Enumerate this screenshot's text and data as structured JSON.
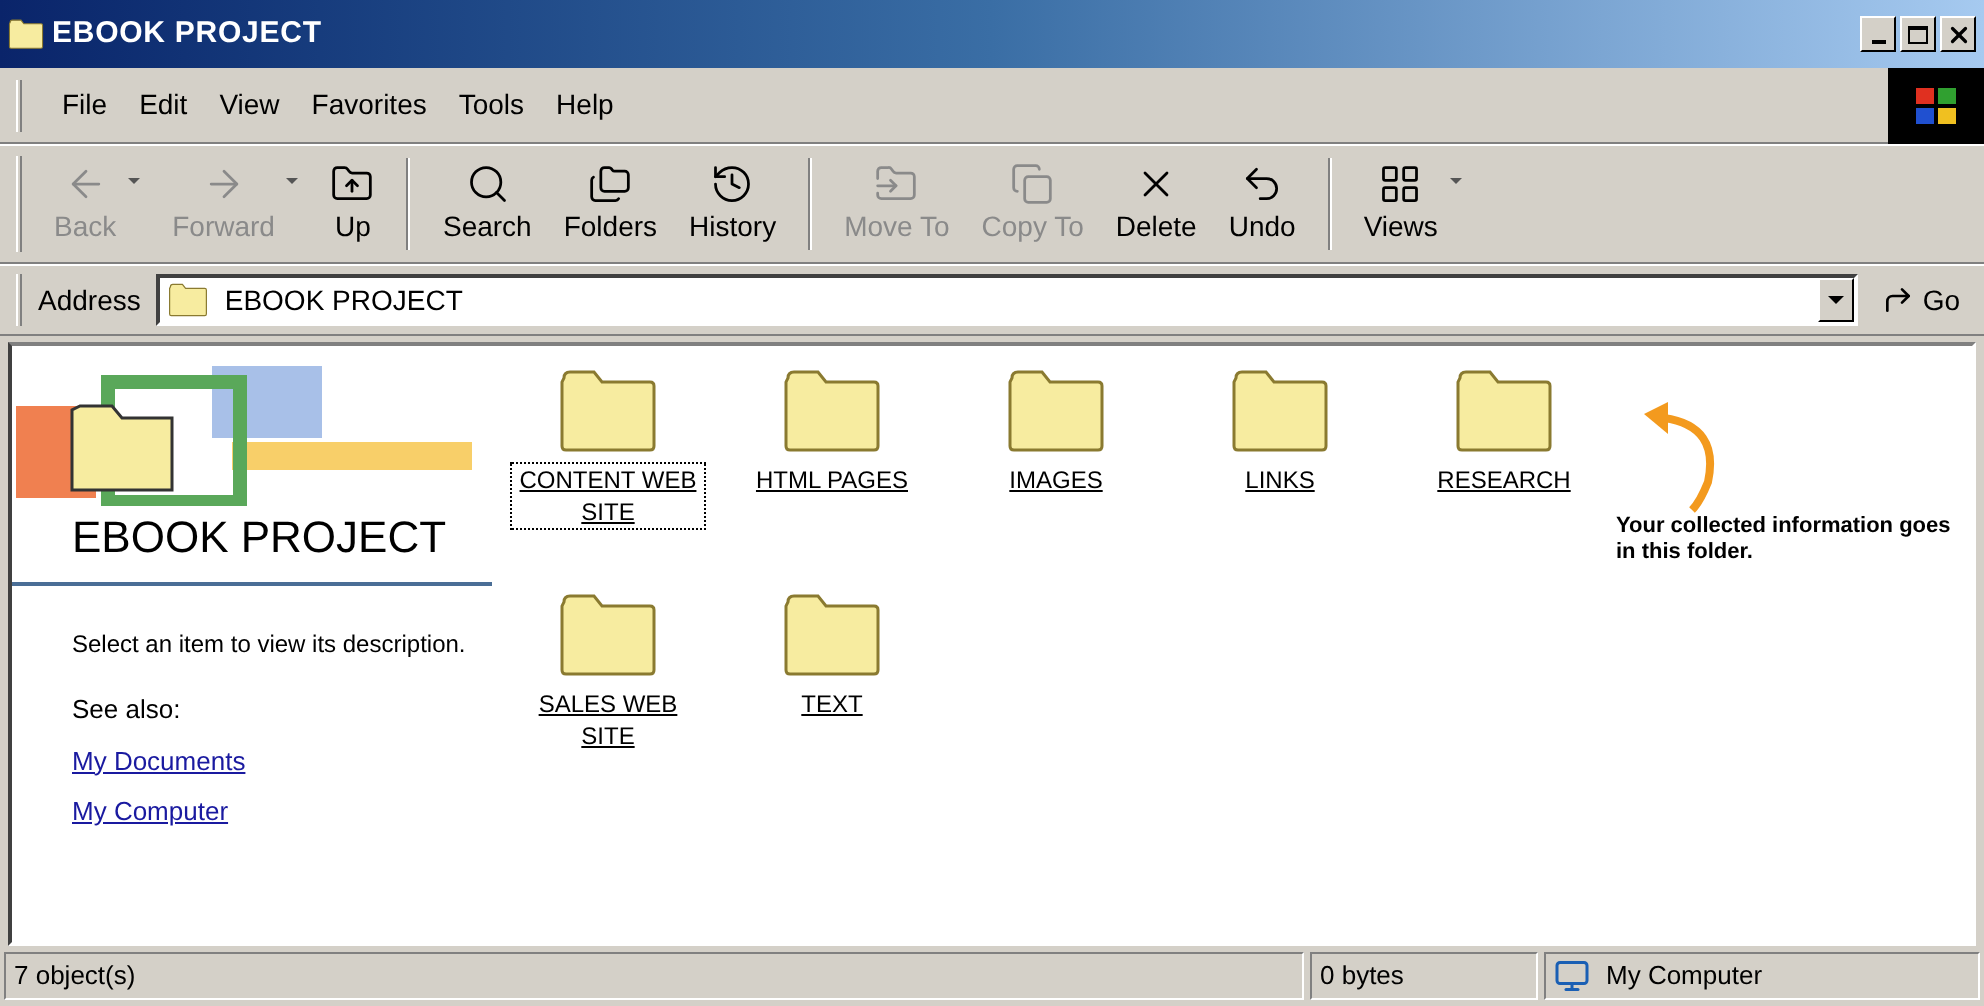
{
  "window": {
    "title": "EBOOK PROJECT"
  },
  "menu": [
    "File",
    "Edit",
    "View",
    "Favorites",
    "Tools",
    "Help"
  ],
  "toolbar": [
    {
      "label": "Back",
      "kind": "back",
      "disabled": true,
      "dropdown": true
    },
    {
      "label": "Forward",
      "kind": "forward",
      "disabled": true,
      "dropdown": true
    },
    {
      "label": "Up",
      "kind": "up",
      "disabled": false,
      "dropdown": false
    },
    {
      "kind": "separator"
    },
    {
      "label": "Search",
      "kind": "search",
      "disabled": false,
      "dropdown": false
    },
    {
      "label": "Folders",
      "kind": "folders",
      "disabled": false,
      "dropdown": false
    },
    {
      "label": "History",
      "kind": "history",
      "disabled": false,
      "dropdown": false
    },
    {
      "kind": "separator"
    },
    {
      "label": "Move To",
      "kind": "move",
      "disabled": true,
      "dropdown": false
    },
    {
      "label": "Copy To",
      "kind": "copy",
      "disabled": true,
      "dropdown": false
    },
    {
      "label": "Delete",
      "kind": "delete",
      "disabled": false,
      "dropdown": false
    },
    {
      "label": "Undo",
      "kind": "undo",
      "disabled": false,
      "dropdown": false
    },
    {
      "kind": "separator"
    },
    {
      "label": "Views",
      "kind": "views",
      "disabled": false,
      "dropdown": true
    }
  ],
  "address": {
    "label": "Address",
    "value": "EBOOK PROJECT",
    "go": "Go"
  },
  "info_panel": {
    "title": "EBOOK PROJECT",
    "description": "Select an item to view its description.",
    "see_also": "See also:",
    "links": [
      "My Documents",
      "My Computer"
    ]
  },
  "folders": [
    {
      "name": "CONTENT WEB SITE",
      "selected": true
    },
    {
      "name": "HTML PAGES",
      "selected": false
    },
    {
      "name": "IMAGES",
      "selected": false
    },
    {
      "name": "LINKS",
      "selected": false
    },
    {
      "name": "RESEARCH",
      "selected": false
    },
    {
      "name": "SALES WEB SITE",
      "selected": false
    },
    {
      "name": "TEXT",
      "selected": false
    }
  ],
  "annotation": "Your collected information goes in this folder.",
  "status_bar": {
    "objects": "7 object(s)",
    "size": "0 bytes",
    "zone": "My Computer"
  }
}
